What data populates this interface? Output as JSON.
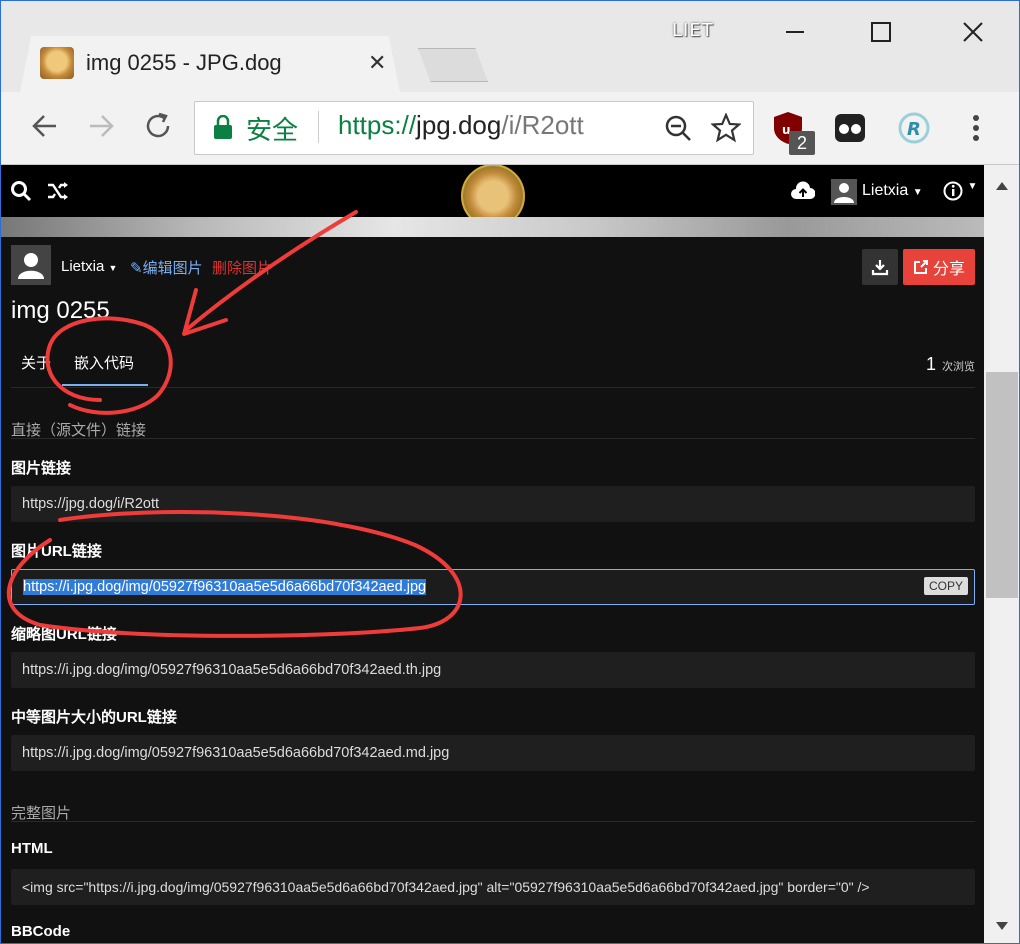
{
  "window": {
    "profile_name": "LIET",
    "tab_title": "img 0255 - JPG.dog"
  },
  "omnibox": {
    "secure_label": "安全",
    "url_scheme": "https://",
    "url_domain": "jpg.dog",
    "url_path": "/i/R2ott"
  },
  "extensions": {
    "ublock_badge": "2"
  },
  "site": {
    "user_name": "Lietxia"
  },
  "image_page": {
    "owner_name": "Lietxia",
    "edit_label": "编辑图片",
    "delete_label": "删除图片",
    "share_label": "分享",
    "title": "img 0255",
    "tabs": [
      "关于",
      "嵌入代码"
    ],
    "view_count": "1",
    "view_label": "次浏览"
  },
  "embed": {
    "section_direct": "直接（源文件）链接",
    "image_link_label": "图片链接",
    "image_link_value": "https://jpg.dog/i/R2ott",
    "image_url_label": "图片URL链接",
    "image_url_value": "https://i.jpg.dog/img/05927f96310aa5e5d6a66bd70f342aed.jpg",
    "copy_label": "COPY",
    "thumb_url_label": "缩略图URL链接",
    "thumb_url_value": "https://i.jpg.dog/img/05927f96310aa5e5d6a66bd70f342aed.th.jpg",
    "medium_url_label": "中等图片大小的URL链接",
    "medium_url_value": "https://i.jpg.dog/img/05927f96310aa5e5d6a66bd70f342aed.md.jpg",
    "section_full": "完整图片",
    "html_label": "HTML",
    "html_value": "<img src=\"https://i.jpg.dog/img/05927f96310aa5e5d6a66bd70f342aed.jpg\" alt=\"05927f96310aa5e5d6a66bd70f342aed.jpg\" border=\"0\" />",
    "bbcode_label": "BBCode"
  },
  "colors": {
    "annotation": "#f03b3b",
    "accent": "#7aaff0",
    "share": "#e8433a",
    "secure_green": "#0b8043"
  }
}
